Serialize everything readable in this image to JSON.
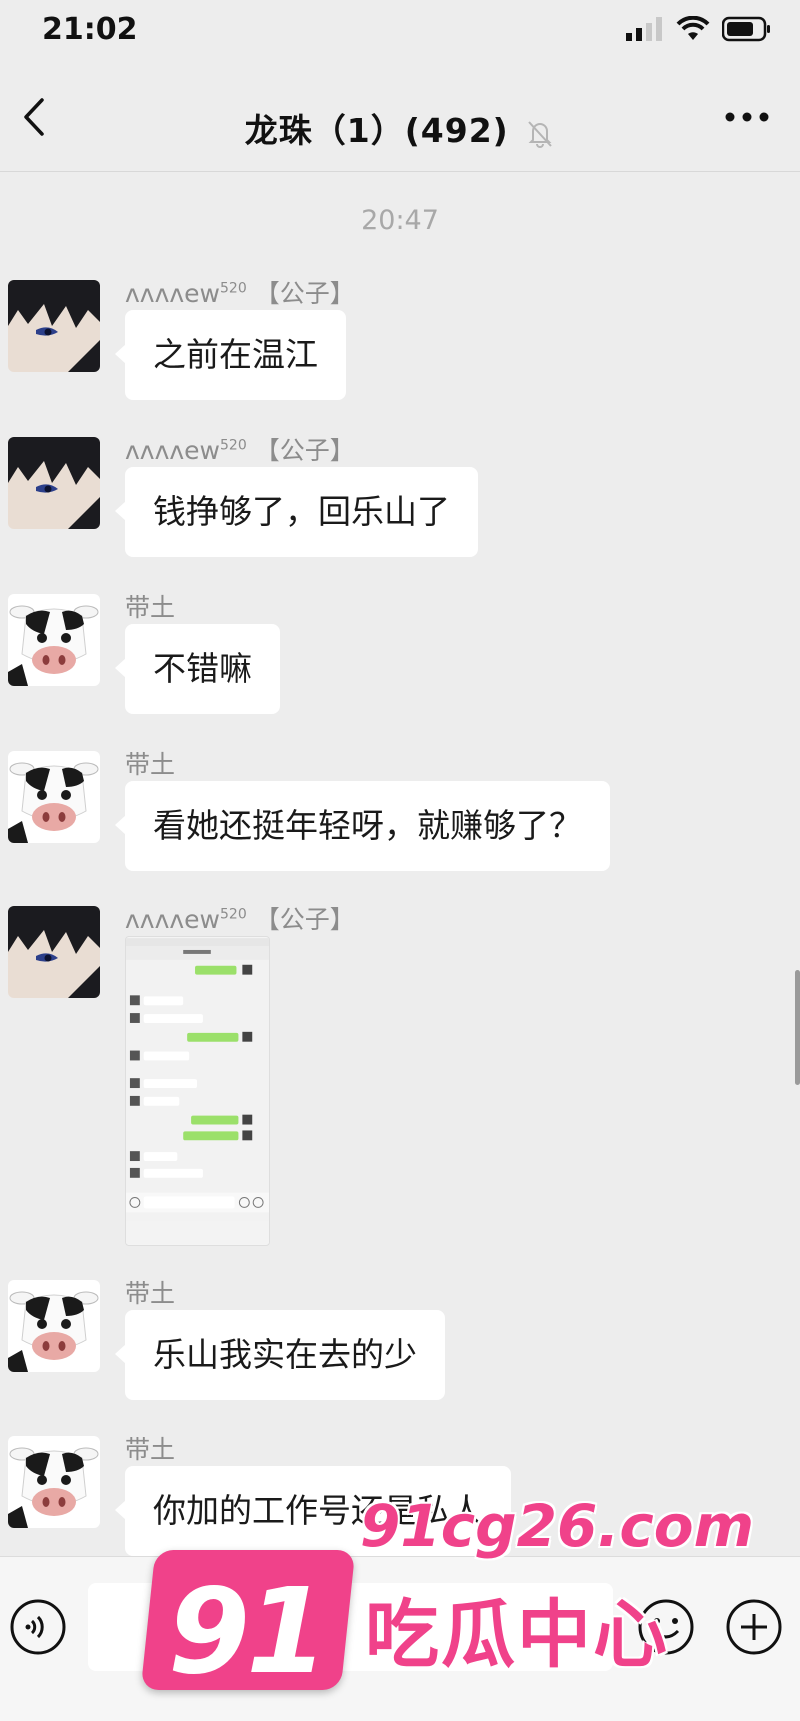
{
  "status_bar": {
    "time": "21:02"
  },
  "header": {
    "title": "龙珠（1）(492)"
  },
  "chat": {
    "timestamp": "20:47",
    "messages": [
      {
        "sender_name": "ᴧᴧᴧᴧew",
        "sender_sup": "520",
        "sender_tag": "【公子】",
        "text": "之前在温江"
      },
      {
        "sender_name": "ᴧᴧᴧᴧew",
        "sender_sup": "520",
        "sender_tag": "【公子】",
        "text": "钱挣够了，回乐山了"
      },
      {
        "sender_name": "带土",
        "text": "不错嘛"
      },
      {
        "sender_name": "带土",
        "text": "看她还挺年轻呀，就赚够了？"
      },
      {
        "sender_name": "ᴧᴧᴧᴧew",
        "sender_sup": "520",
        "sender_tag": "【公子】",
        "type": "image"
      },
      {
        "sender_name": "带土",
        "text": "乐山我实在去的少"
      },
      {
        "sender_name": "带土",
        "text": "你加的工作号还是私人"
      }
    ]
  },
  "watermark": {
    "number": "91",
    "domain": "91cg26.com",
    "brand": "吃瓜中心",
    "color": "#f0428a"
  },
  "colors": {
    "background": "#ededed",
    "bubble": "#ffffff",
    "sender": "#8c8c8c"
  }
}
